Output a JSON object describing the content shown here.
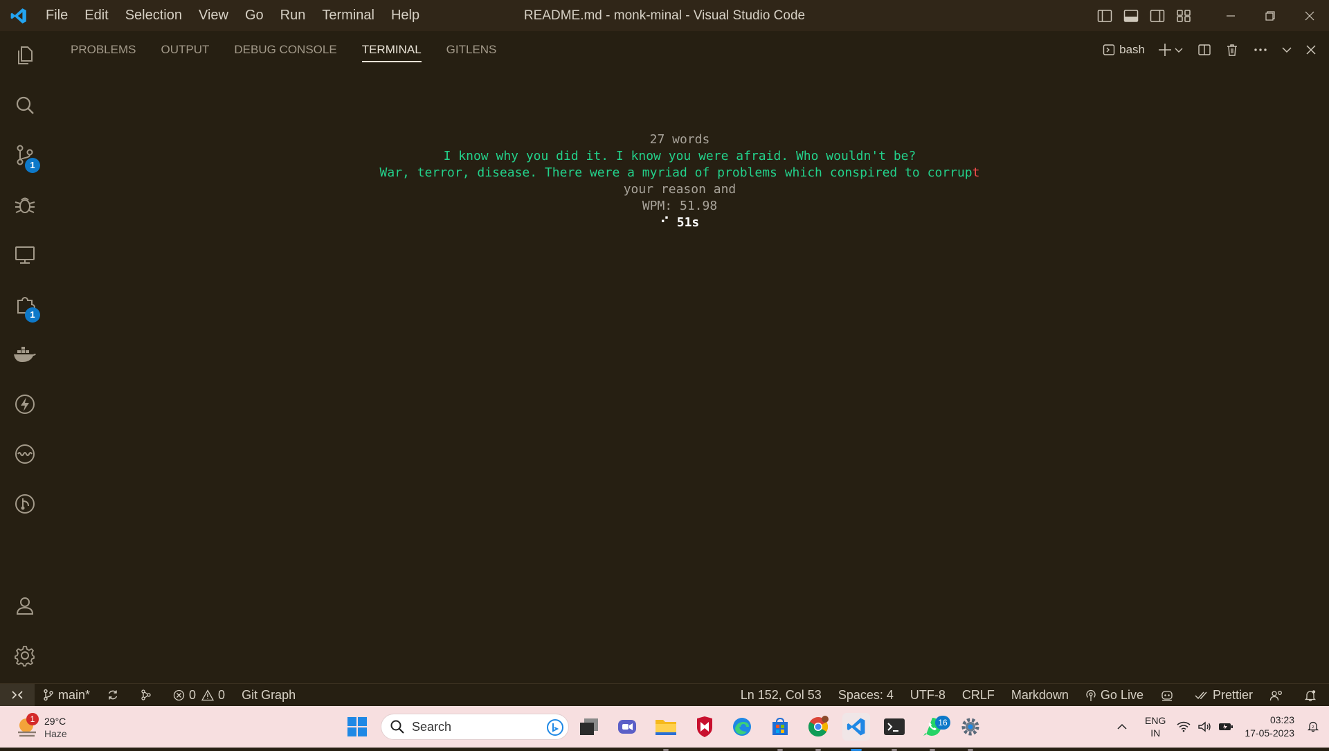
{
  "titlebar": {
    "menu": [
      "File",
      "Edit",
      "Selection",
      "View",
      "Go",
      "Run",
      "Terminal",
      "Help"
    ],
    "title": "README.md - monk-minal - Visual Studio Code",
    "icons": [
      "toggle-primary-sidebar-icon",
      "toggle-panel-icon",
      "toggle-secondary-sidebar-icon",
      "customize-layout-icon",
      "minimize-icon",
      "restore-icon",
      "close-icon"
    ]
  },
  "activitybar": {
    "items": [
      {
        "name": "explorer-icon"
      },
      {
        "name": "search-icon"
      },
      {
        "name": "source-control-icon",
        "badge": "1"
      },
      {
        "name": "run-debug-icon"
      },
      {
        "name": "remote-explorer-icon"
      },
      {
        "name": "extensions-icon",
        "badge": "1"
      },
      {
        "name": "docker-icon"
      },
      {
        "name": "thunder-client-icon"
      },
      {
        "name": "live-share-icon"
      },
      {
        "name": "git-graph-icon"
      }
    ],
    "bottom": [
      {
        "name": "accounts-icon"
      },
      {
        "name": "manage-gear-icon"
      }
    ]
  },
  "panel": {
    "tabs": [
      "PROBLEMS",
      "OUTPUT",
      "DEBUG CONSOLE",
      "TERMINAL",
      "GITLENS"
    ],
    "active_tab": "TERMINAL",
    "terminal_name": "bash"
  },
  "terminal": {
    "word_count": "27 words",
    "line1": "I know why you did it. I know you were afraid. Who wouldn't be?",
    "line2_typed": "War, terror, disease. There were a myriad of problems which conspired to corrup",
    "line2_error": "t",
    "line3": "your reason and",
    "wpm": "WPM: 51.98",
    "spinner": "⠊",
    "timer": "51s"
  },
  "statusbar": {
    "branch": "main*",
    "errors": "0",
    "warnings": "0",
    "git_graph": "Git Graph",
    "position": "Ln 152, Col 53",
    "spaces": "Spaces: 4",
    "encoding": "UTF-8",
    "eol": "CRLF",
    "language": "Markdown",
    "go_live": "Go Live",
    "prettier": "Prettier"
  },
  "taskbar": {
    "weather_temp": "29°C",
    "weather_desc": "Haze",
    "weather_badge": "1",
    "search_placeholder": "Search",
    "whatsapp_badge": "16",
    "lang_line1": "ENG",
    "lang_line2": "IN",
    "time": "03:23",
    "date": "17-05-2023"
  },
  "colors": {
    "typed_correct": "#23d18b",
    "typed_error": "#f14c4c",
    "pending": "#a8a39a",
    "accent": "#0e79c9"
  }
}
